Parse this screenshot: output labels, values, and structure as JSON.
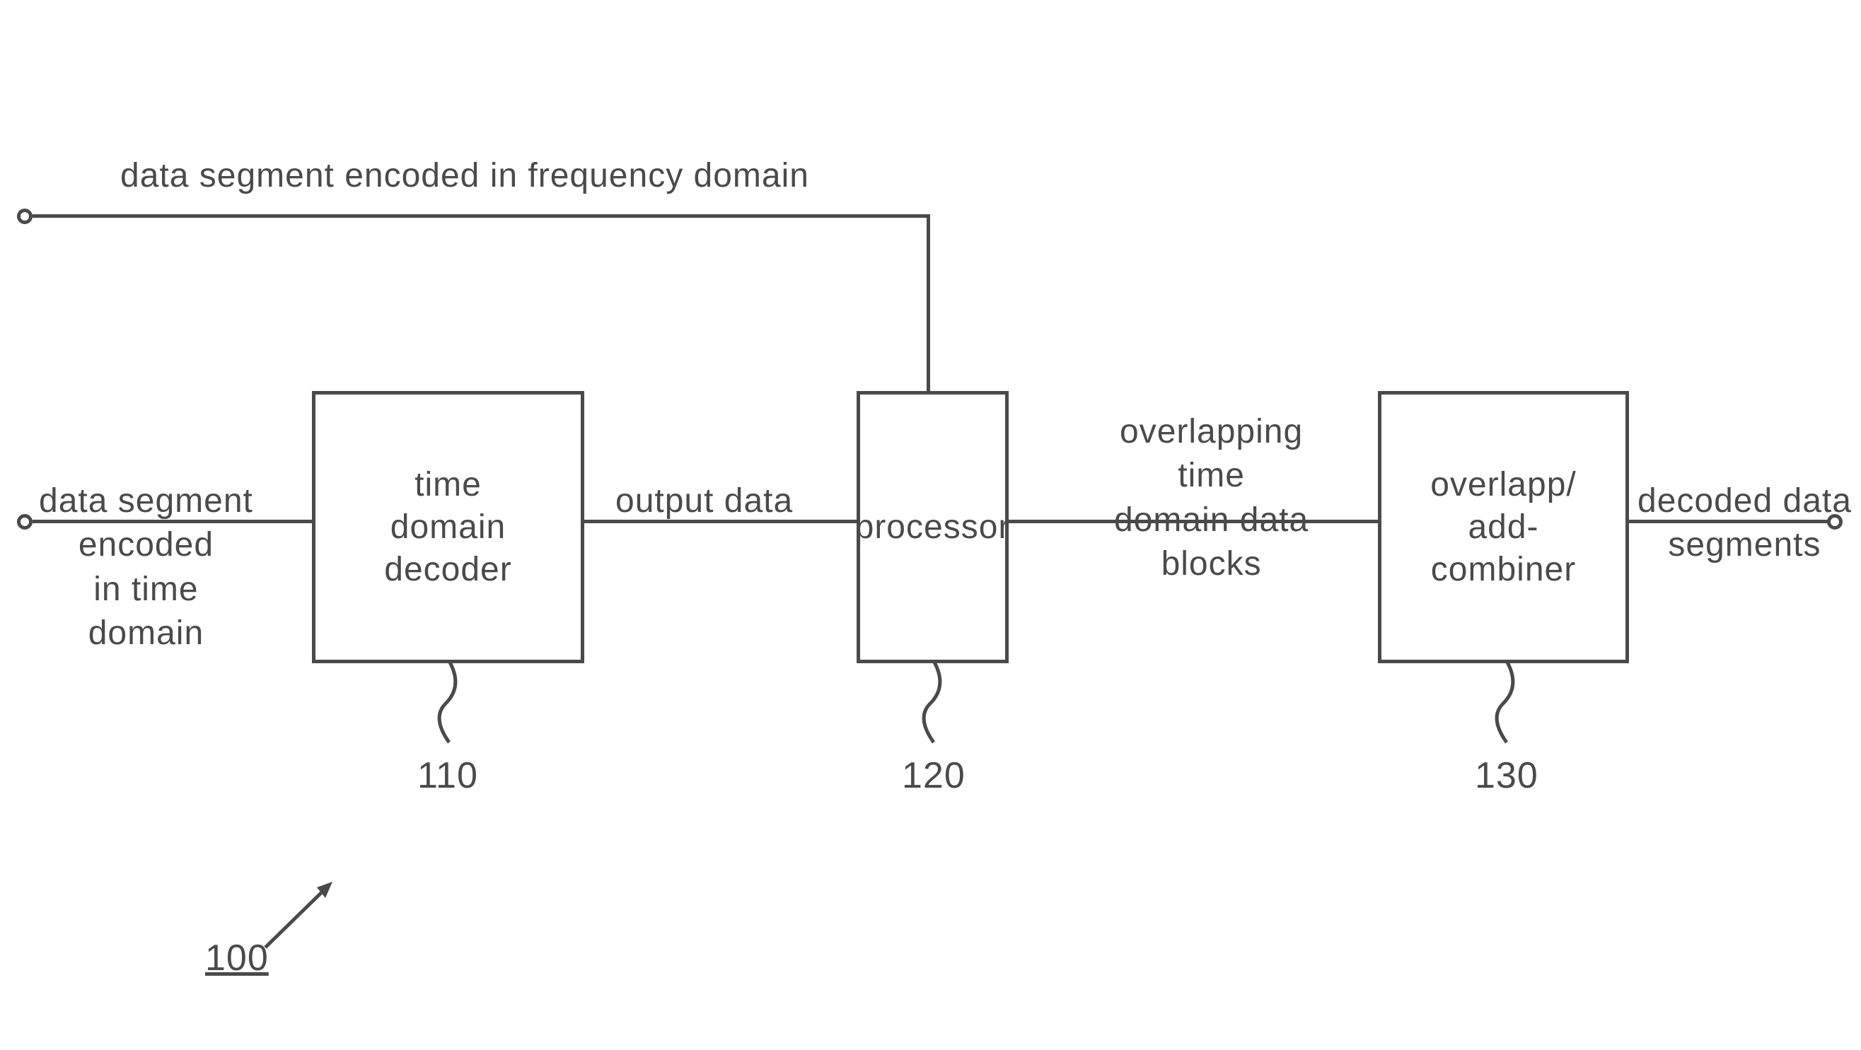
{
  "inputs": {
    "freq": "data segment encoded in frequency domain",
    "time": "data segment\nencoded\nin time\ndomain"
  },
  "blocks": {
    "decoder": {
      "label": "time\ndomain\ndecoder",
      "ref": "110"
    },
    "processor": {
      "label": "processor",
      "ref": "120"
    },
    "combiner": {
      "label": "overlapp/\nadd-\ncombiner",
      "ref": "130"
    }
  },
  "signals": {
    "output_data": "output data",
    "overlap_blocks": "overlapping\ntime\ndomain data\nblocks",
    "decoded": "decoded data\nsegments"
  },
  "figure_ref": "100"
}
